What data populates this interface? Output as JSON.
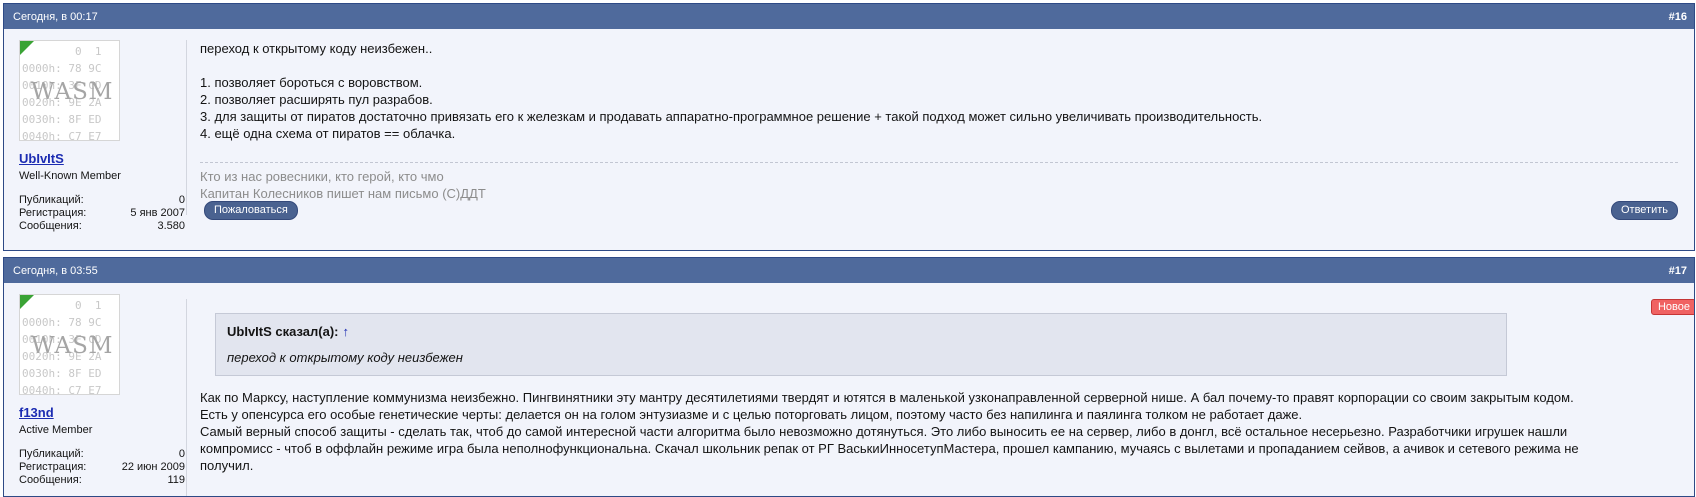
{
  "posts": [
    {
      "date": "Сегодня, в 00:17",
      "number": "#16",
      "user": {
        "name": "UbIvItS",
        "title": "Well-Known Member",
        "avatar_label": "WASM",
        "avatar_lines": [
          "        0  1",
          "0000h: 78 9C",
          "0010h: 3F CD",
          "0020h: 9E 2A",
          "0030h: 8F ED",
          "0040h: C7 E7"
        ],
        "stats": [
          {
            "label": "Публикаций:",
            "value": "0"
          },
          {
            "label": "Регистрация:",
            "value": "5 янв 2007"
          },
          {
            "label": "Сообщения:",
            "value": "3.580"
          }
        ]
      },
      "body": [
        "переход к открытому коду неизбежен..",
        "",
        "1. позволяет бороться с воровством.",
        "2. позволяет расширять пул разрабов.",
        "3. для защиты от пиратов достаточно привязать его к железкам и продавать аппаратно-программное решение + такой подход может сильно увеличивать производительность.",
        "4. ещё одна схема от пиратов == облачка."
      ],
      "signature": [
        "Кто из нас ровесники, кто герой, кто чмо",
        "Капитан Колесников пишет нам письмо (С)ДДТ"
      ],
      "report_label": "Пожаловаться",
      "reply_label": "Ответить"
    },
    {
      "date": "Сегодня, в 03:55",
      "number": "#17",
      "badge": "Новое",
      "user": {
        "name": "f13nd",
        "title": "Active Member",
        "avatar_label": "WASM",
        "avatar_lines": [
          "        0  1",
          "0000h: 78 9C",
          "0010h: 3F CD",
          "0020h: 9E 2A",
          "0030h: 8F ED",
          "0040h: C7 E7"
        ],
        "stats": [
          {
            "label": "Публикаций:",
            "value": "0"
          },
          {
            "label": "Регистрация:",
            "value": "22 июн 2009"
          },
          {
            "label": "Сообщения:",
            "value": "119"
          }
        ]
      },
      "quote": {
        "author": "UbIvItS сказал(а):",
        "arrow": "↑",
        "text": "переход к открытому коду неизбежен"
      },
      "body": [
        "Как по Марксу, наступление коммунизма неизбежно. Пингвинятники эту мантру десятилетиями твердят и ютятся в маленькой узконаправленной серверной нише. А бал почему-то правят корпорации со своим закрытым кодом.",
        "Есть у опенсурса его особые генетические черты: делается он на голом энтузиазме и с целью поторговать лицом, поэтому часто без напилинга и паялинга толком не работает даже.",
        "Самый верный способ защиты - сделать так, чтоб до самой интересной части алгоритма было невозможно дотянуться. Это либо выносить ее на сервер, либо в донгл, всё остальное несерьезно. Разработчики игрушек нашли",
        "компромисс - чтоб в оффлайн режиме игра была неполнофункциональна. Скачал школьник репак от РГ ВаськиИнносетупМастера, прошел кампанию, мучаясь с вылетами и пропаданием сейвов, а ачивок и сетевого режима не",
        "получил."
      ]
    }
  ]
}
